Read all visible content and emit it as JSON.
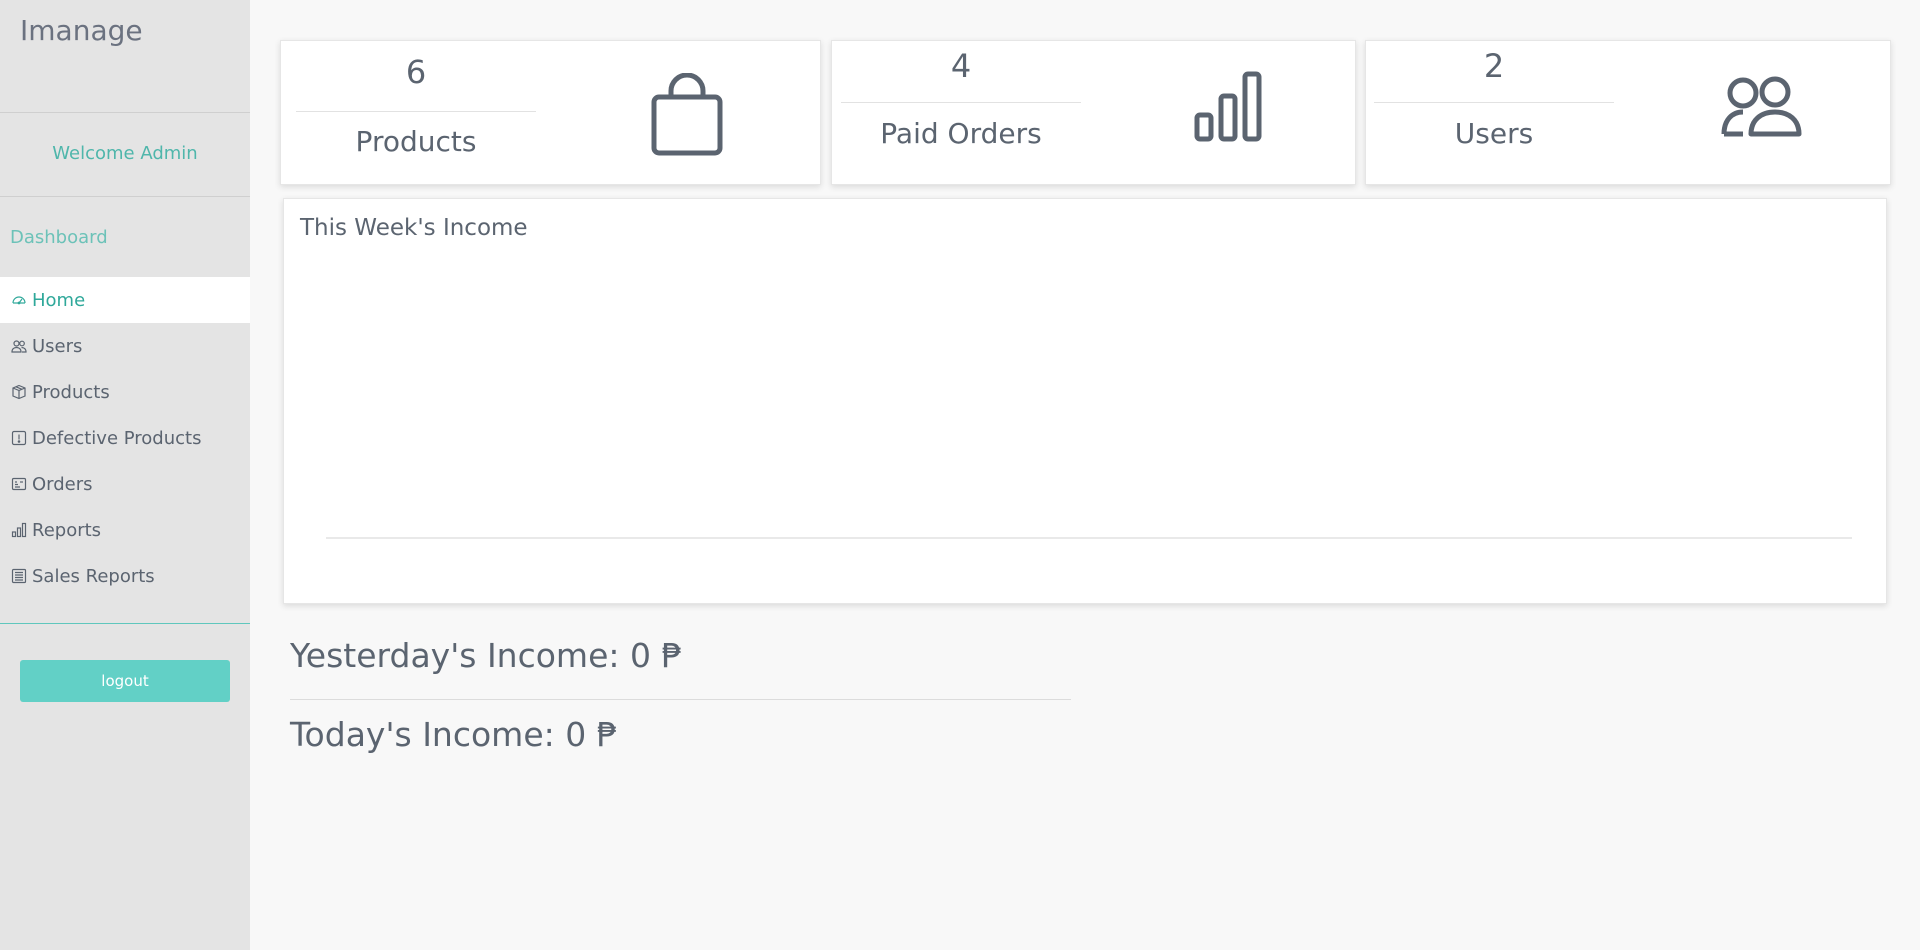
{
  "sidebar": {
    "brand": "Imanage",
    "welcome": "Welcome Admin",
    "section_title": "Dashboard",
    "items": [
      {
        "label": "Home",
        "icon": "speedometer-icon",
        "active": true
      },
      {
        "label": "Users",
        "icon": "users-icon",
        "active": false
      },
      {
        "label": "Products",
        "icon": "box-icon",
        "active": false
      },
      {
        "label": "Defective Products",
        "icon": "exclamation-square-icon",
        "active": false
      },
      {
        "label": "Orders",
        "icon": "receipt-card-icon",
        "active": false
      },
      {
        "label": "Reports",
        "icon": "bar-chart-icon",
        "active": false
      },
      {
        "label": "Sales Reports",
        "icon": "document-list-icon",
        "active": false
      }
    ],
    "logout_label": "logout"
  },
  "stats": [
    {
      "value": "6",
      "label": "Products",
      "icon": "shopping-bag-icon"
    },
    {
      "value": "4",
      "label": "Paid Orders",
      "icon": "bar-chart-icon"
    },
    {
      "value": "2",
      "label": "Users",
      "icon": "people-icon"
    }
  ],
  "income_chart": {
    "title": "This Week's Income"
  },
  "chart_data": {
    "type": "line",
    "title": "This Week's Income",
    "categories": [],
    "series": [],
    "xlabel": "",
    "ylabel": ""
  },
  "summary": {
    "yesterday": "Yesterday's Income: 0 ₱",
    "today": "Today's Income: 0 ₱"
  },
  "colors": {
    "accent": "#62d0c6",
    "accent_text": "#2fa89a",
    "sidebar_bg": "#e4e4e4",
    "text": "#5b6470"
  }
}
